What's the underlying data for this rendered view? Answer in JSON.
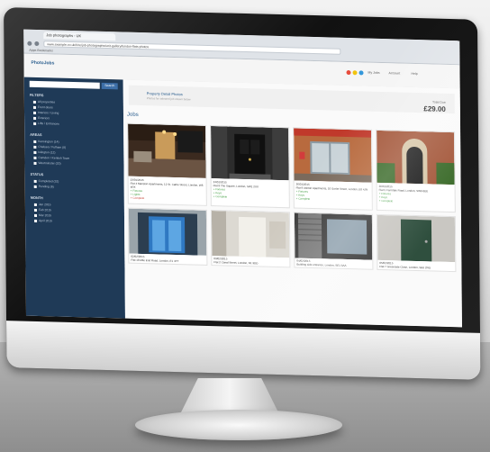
{
  "browser": {
    "tab_title": "Job photographs - UK",
    "address": "www.example.co.uk/hire/job-photographs/unit-gallery/london-flats-photos",
    "bookmark": "Apps  Bookmarks"
  },
  "app": {
    "logo": "PhotoJobs",
    "top_links": [
      "My Jobs",
      "Account",
      "Help"
    ]
  },
  "sidebar": {
    "search_placeholder": "",
    "search_button": "Search",
    "filters_title": "FILTERS",
    "filter_items": [
      "All properties",
      "Front doors",
      "Interiors / Living",
      "Exteriors",
      "Lifts / Entrances"
    ],
    "areas_title": "AREAS",
    "area_items": [
      "Kensington (14)",
      "Chelsea / Fulham (8)",
      "Islington (12)",
      "Camden / Kentish Town",
      "Westminster (20)"
    ],
    "status_title": "STATUS",
    "status_items": [
      "Completed (32)",
      "Pending (6)"
    ],
    "months_title": "MONTH",
    "month_items": [
      "Jan 2015",
      "Feb 2015",
      "Mar 2015",
      "April 2015"
    ]
  },
  "main": {
    "hero_name": "Property Detail Photos",
    "hero_sub": "Photos for selected job shown below",
    "price_label": "Total Due",
    "price": "£29.00",
    "section_title": "Jobs",
    "cards": [
      {
        "date": "23/01/2015",
        "title": "Flat 4 Mansion Apartments, 12 St. Cathe Street, London, W8 4RX",
        "l1": "+ Fixtures",
        "l2": "+ Lights",
        "l3": "+ Complete",
        "scene": "interior"
      },
      {
        "date": "24/01/2015",
        "title": "Flat 8 The Square, London, SW1 2XX",
        "l1": "+ Fixtures",
        "l2": "+ Keys",
        "l3": "+ Complete",
        "scene": "blackdoor"
      },
      {
        "date": "26/01/2015",
        "title": "Flat 9 Ashton Apartments, 10 Gorlet Street, London, E8 4JN",
        "l1": "+ Fixtures",
        "l2": "+ Keys",
        "l3": "+ Complete",
        "scene": "shopfront"
      },
      {
        "date": "26/01/2015",
        "title": "Flat 5 Ferndale Road, London, SW9 8EE",
        "l1": "+ Fixtures",
        "l2": "+ Keys",
        "l3": "+ Complete",
        "scene": "archdoor"
      },
      {
        "date": "02/02/2015",
        "title": "Flat 18 Mile End Road, London, E1 4TT",
        "scene": "bluelift"
      },
      {
        "date": "03/02/2015",
        "title": "Flat 2 Canal Street, London, N1 9DD",
        "scene": "whitedoor"
      },
      {
        "date": "04/02/2015",
        "title": "Building side entrance, London, SE1 3AA",
        "scene": "shutters"
      },
      {
        "date": "05/02/2015",
        "title": "Flat 7 Greenside Close, London, SE6 2NG",
        "scene": "greendoor"
      }
    ]
  },
  "colors": {
    "sidebar": "#1f3a57",
    "accent": "#2c5f8f",
    "bezel": "#111111"
  }
}
